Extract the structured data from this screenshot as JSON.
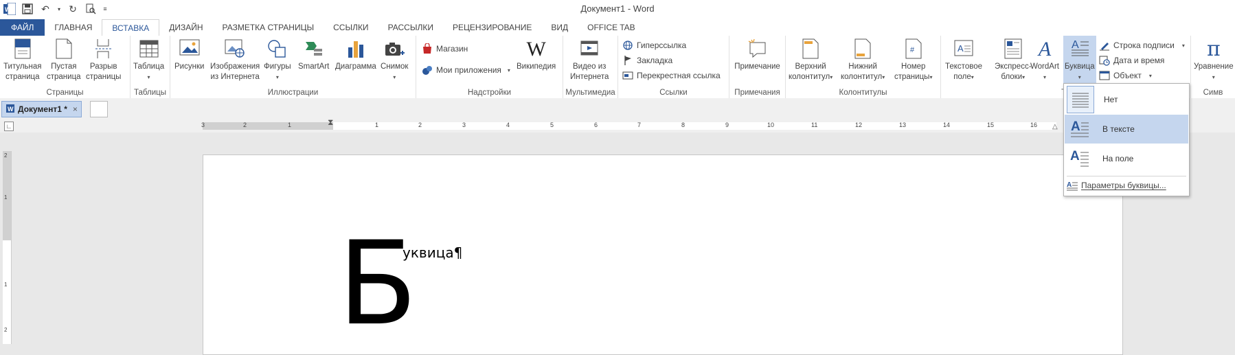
{
  "window": {
    "title": "Документ1 - Word"
  },
  "tabs": [
    "ФАЙЛ",
    "ГЛАВНАЯ",
    "ВСТАВКА",
    "ДИЗАЙН",
    "РАЗМЕТКА СТРАНИЦЫ",
    "ССЫЛКИ",
    "РАССЫЛКИ",
    "РЕЦЕНЗИРОВАНИЕ",
    "ВИД",
    "OFFICE TAB"
  ],
  "ribbon": {
    "pages": {
      "label": "Страницы",
      "title_page": [
        "Титульная",
        "страница"
      ],
      "blank_page": [
        "Пустая",
        "страница"
      ],
      "page_break": [
        "Разрыв",
        "страницы"
      ]
    },
    "tables": {
      "label": "Таблицы",
      "table": "Таблица"
    },
    "illustrations": {
      "label": "Иллюстрации",
      "pictures": "Рисунки",
      "online_pictures": [
        "Изображения",
        "из Интернета"
      ],
      "shapes": "Фигуры",
      "smartart": "SmartArt",
      "chart": "Диаграмма",
      "screenshot": "Снимок"
    },
    "addins": {
      "label": "Надстройки",
      "store": "Магазин",
      "my_apps": "Мои приложения",
      "wikipedia": "Википедия"
    },
    "media": {
      "label": "Мультимедиа",
      "online_video": [
        "Видео из",
        "Интернета"
      ]
    },
    "links": {
      "label": "Ссылки",
      "hyperlink": "Гиперссылка",
      "bookmark": "Закладка",
      "cross_reference": "Перекрестная ссылка"
    },
    "comments": {
      "label": "Примечания",
      "comment": "Примечание"
    },
    "header_footer": {
      "label": "Колонтитулы",
      "header": [
        "Верхний",
        "колонтитул"
      ],
      "footer": [
        "Нижний",
        "колонтитул"
      ],
      "page_number": [
        "Номер",
        "страницы"
      ]
    },
    "text": {
      "label": "Те",
      "text_box": [
        "Текстовое",
        "поле"
      ],
      "quick_parts": [
        "Экспресс-",
        "блоки"
      ],
      "wordart": "WordArt",
      "dropcap": "Буквица",
      "signature_line": "Строка подписи",
      "date_time": "Дата и время",
      "object": "Объект"
    },
    "symbols": {
      "label": "Симв",
      "equation": "Уравнение"
    }
  },
  "doc_tab": {
    "name": "Документ1 *",
    "close": "×"
  },
  "ruler": {
    "left": [
      "3",
      "2",
      "1"
    ],
    "right": [
      "1",
      "2",
      "3",
      "4",
      "5",
      "6",
      "7",
      "8",
      "9",
      "10",
      "11",
      "12",
      "13",
      "14",
      "15",
      "16"
    ],
    "vertical": [
      "2",
      "1",
      "1",
      "2"
    ]
  },
  "document": {
    "dropcap_letter": "Б",
    "rest_text": "уквица¶"
  },
  "dropcap_menu": {
    "items": [
      "Нет",
      "В тексте",
      "На поле"
    ],
    "options": "Параметры буквицы..."
  },
  "colors": {
    "accent": "#2b579a",
    "highlight": "#c5d6ee"
  }
}
